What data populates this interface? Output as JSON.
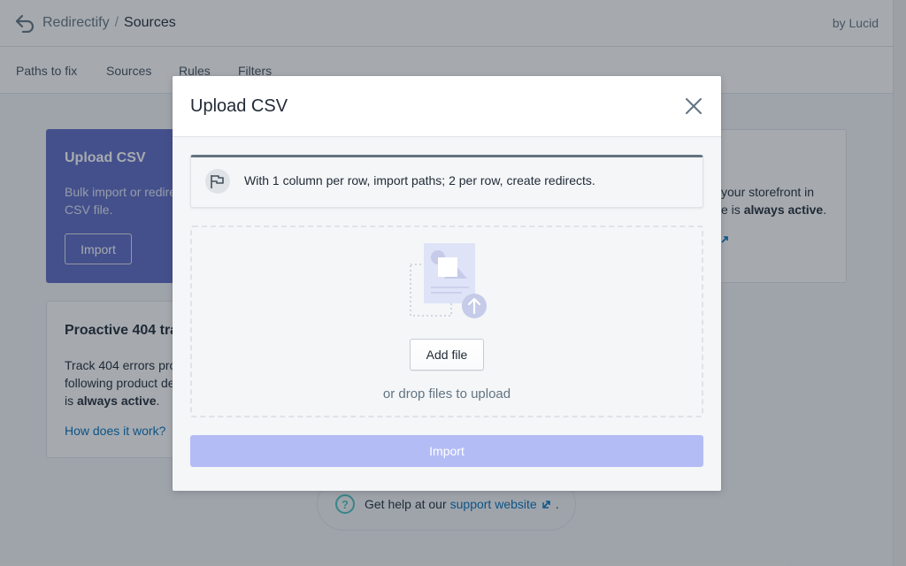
{
  "app": {
    "name": "Redirectify",
    "separator": "/",
    "current_page": "Sources",
    "byline": "by Lucid"
  },
  "nav": {
    "items": [
      {
        "label": "Paths to fix"
      },
      {
        "label": "Sources"
      },
      {
        "label": "Rules"
      },
      {
        "label": "Filters"
      }
    ]
  },
  "background": {
    "upload_card": {
      "title": "Upload CSV",
      "description": "Bulk import or redire a CSV file.",
      "button": "Import"
    },
    "right_card": {
      "description_prefix": "your storefront in",
      "description_mid": "e is ",
      "description_bold": "always active",
      "description_suffix": "."
    },
    "proactive_card": {
      "title": "Proactive 404 tra",
      "description": "Track 404 errors pro following product de is ",
      "description_bold": "always active",
      "description_suffix": ".",
      "link": "How does it work?"
    },
    "help": {
      "prefix": "Get help at our",
      "link": "support website",
      "suffix": "."
    }
  },
  "modal": {
    "title": "Upload CSV",
    "banner_text": "With 1 column per row, import paths; 2 per row, create redirects.",
    "add_file_label": "Add file",
    "drop_hint": "or drop files to upload",
    "import_label": "Import",
    "import_disabled": true
  },
  "colors": {
    "brand": "#5c6ac4",
    "primary_disabled": "#b3bcf5",
    "link": "#006fbb",
    "help_accent": "#47c1bf"
  },
  "icons": {
    "logo": "redirect-arrow-icon",
    "close": "close-icon",
    "banner": "flag-icon",
    "upload": "upload-file-illustration",
    "external": "external-link-icon",
    "help": "question-circle-icon"
  }
}
